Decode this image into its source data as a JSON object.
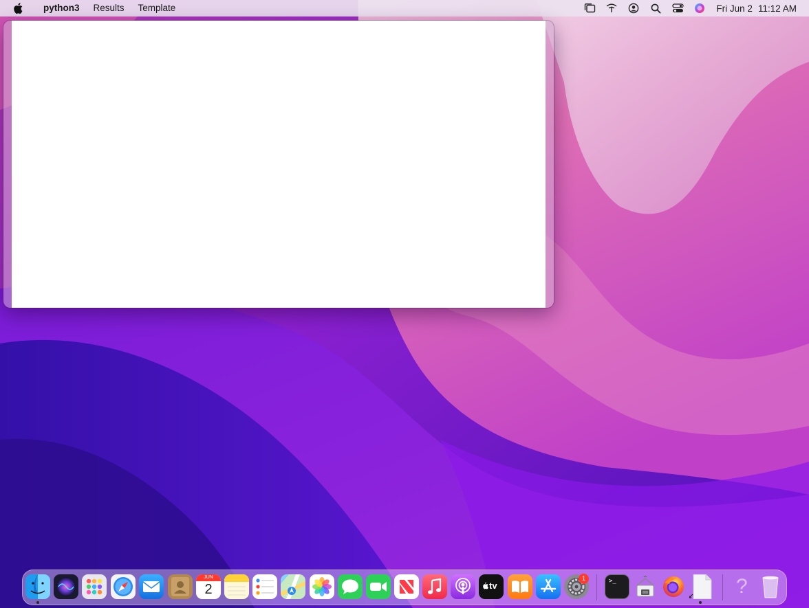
{
  "menubar": {
    "app_name": "python3",
    "menus": [
      "Results",
      "Template"
    ],
    "date": "Fri Jun 2",
    "time": "11:12 AM",
    "status_icons": [
      "stage-manager-icon",
      "wifi-icon",
      "user-account-icon",
      "search-icon",
      "control-center-icon",
      "siri-icon"
    ]
  },
  "window": {
    "title": ""
  },
  "dock": {
    "calendar_month": "JUN",
    "calendar_day": "2",
    "settings_badge": "1",
    "tv_label": "tv",
    "help_glyph": "?",
    "terminal_prompt": ">_",
    "items": [
      "finder",
      "siri",
      "launchpad",
      "safari",
      "mail",
      "contacts",
      "calendar",
      "notes",
      "reminders",
      "maps",
      "photos",
      "messages",
      "facetime",
      "news",
      "music",
      "podcasts",
      "tv",
      "books",
      "app-store",
      "system-settings",
      "terminal",
      "python-launcher",
      "firefox",
      "document",
      "help",
      "trash"
    ]
  },
  "colors": {
    "wallpaper_purple": "#5a12c8",
    "wallpaper_pink": "#e05cae",
    "menubar_bg": "#ece2f0",
    "window_content": "#ffffff"
  }
}
